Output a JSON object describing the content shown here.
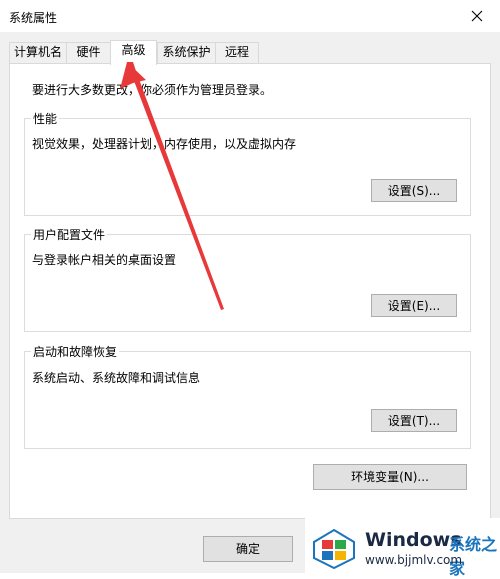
{
  "window": {
    "title": "系统属性"
  },
  "tabs": [
    {
      "label": "计算机名"
    },
    {
      "label": "硬件"
    },
    {
      "label": "高级"
    },
    {
      "label": "系统保护"
    },
    {
      "label": "远程"
    }
  ],
  "active_tab": "高级",
  "admin_note": "要进行大多数更改，你必须作为管理员登录。",
  "groups": {
    "performance": {
      "title": "性能",
      "description": "视觉效果，处理器计划，内存使用，以及虚拟内存",
      "button": "设置(S)..."
    },
    "user_profiles": {
      "title": "用户配置文件",
      "description": "与登录帐户相关的桌面设置",
      "button": "设置(E)..."
    },
    "startup_recovery": {
      "title": "启动和故障恢复",
      "description": "系统启动、系统故障和调试信息",
      "button": "设置(T)..."
    }
  },
  "env_button": "环境变量(N)...",
  "ok_button": "确定",
  "watermark": {
    "brand": "Windows",
    "brand_cn": "系统之家",
    "url": "www.bjjmlv.com"
  },
  "colors": {
    "arrow": "#e8393a",
    "logo_red": "#e8393a",
    "logo_blue": "#1b75bc",
    "logo_green": "#2aa84a",
    "logo_yellow": "#f5b400"
  }
}
